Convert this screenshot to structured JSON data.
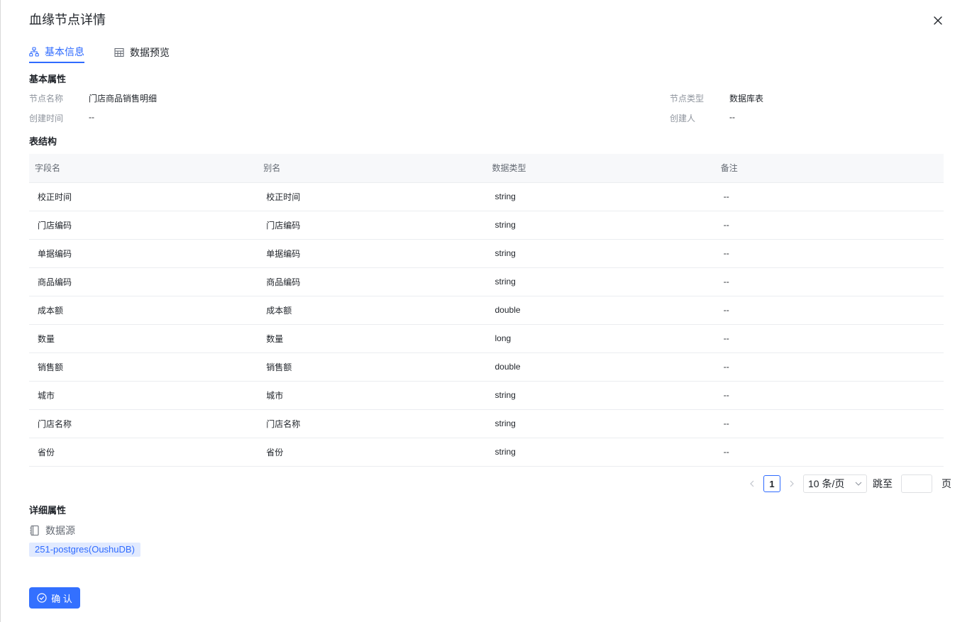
{
  "dialog": {
    "title": "血缘节点详情",
    "close_icon": "close-icon"
  },
  "tabs": [
    {
      "label": "基本信息",
      "icon": "lineage-icon",
      "active": true
    },
    {
      "label": "数据预览",
      "icon": "table-icon",
      "active": false
    }
  ],
  "basic": {
    "section_title": "基本属性",
    "node_name_label": "节点名称",
    "node_name_value": "门店商品销售明细",
    "node_type_label": "节点类型",
    "node_type_value": "数据库表",
    "created_time_label": "创建时间",
    "created_time_value": "--",
    "creator_label": "创建人",
    "creator_value": "--"
  },
  "schema": {
    "section_title": "表结构",
    "columns": [
      "字段名",
      "别名",
      "数据类型",
      "备注"
    ],
    "rows": [
      [
        "校正时间",
        "校正时间",
        "string",
        "--"
      ],
      [
        "门店编码",
        "门店编码",
        "string",
        "--"
      ],
      [
        "单据编码",
        "单据编码",
        "string",
        "--"
      ],
      [
        "商品编码",
        "商品编码",
        "string",
        "--"
      ],
      [
        "成本额",
        "成本额",
        "double",
        "--"
      ],
      [
        "数量",
        "数量",
        "long",
        "--"
      ],
      [
        "销售额",
        "销售额",
        "double",
        "--"
      ],
      [
        "城市",
        "城市",
        "string",
        "--"
      ],
      [
        "门店名称",
        "门店名称",
        "string",
        "--"
      ],
      [
        "省份",
        "省份",
        "string",
        "--"
      ]
    ]
  },
  "pagination": {
    "current_page": "1",
    "page_size": "10 条/页",
    "jump_label": "跳至",
    "page_suffix": "页",
    "jump_value": ""
  },
  "detail": {
    "section_title": "详细属性",
    "datasource_label": "数据源",
    "datasource_value": "251-postgres(OushuDB)"
  },
  "footer": {
    "confirm_label": "确 认"
  },
  "colors": {
    "accent": "#3370ff",
    "tag_bg": "#e1eaff"
  }
}
